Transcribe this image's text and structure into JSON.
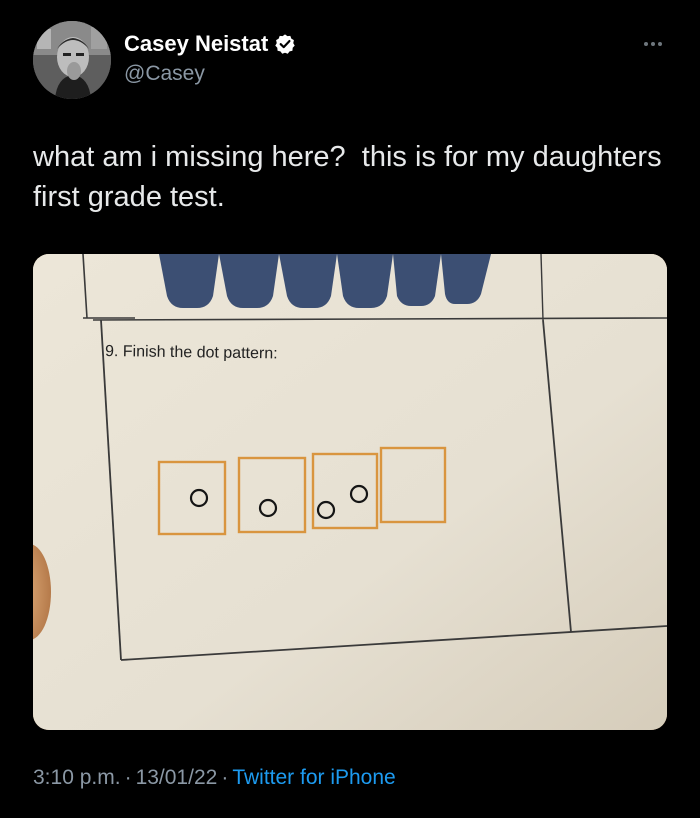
{
  "author": {
    "name": "Casey Neistat",
    "handle": "@Casey",
    "verified": true
  },
  "tweet": {
    "text": "what am i missing here?  this is for my daughters first grade test."
  },
  "media": {
    "question_label": "9. Finish the dot pattern:",
    "dot_boxes": [
      1,
      1,
      2,
      0
    ]
  },
  "meta": {
    "time": "3:10 p.m.",
    "date": "13/01/22",
    "separator": "·",
    "source": "Twitter for iPhone"
  },
  "icons": {
    "verified": "verified-badge-icon",
    "more": "more-dots-icon"
  },
  "colors": {
    "background": "#000000",
    "text": "#e7e9ea",
    "muted": "#8b98a5",
    "link": "#1d9bf0",
    "box_outline": "#d9953f"
  }
}
